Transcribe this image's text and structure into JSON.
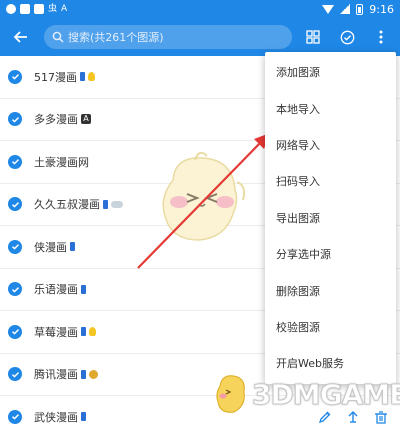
{
  "status_bar": {
    "time": "9:16",
    "left_icons": [
      "notification-icon",
      "square-icon",
      "square-icon",
      "bug-icon",
      "a-icon"
    ],
    "right_icons": [
      "wifi-icon",
      "signal-icon",
      "battery-icon"
    ]
  },
  "toolbar": {
    "search_placeholder": "搜索(共261个图源)",
    "icons": [
      "back-arrow-icon",
      "search-icon",
      "grid-icon",
      "check-circle-icon",
      "more-vert-icon"
    ]
  },
  "sources": [
    {
      "name": "517漫画",
      "tags": [
        "phone",
        "bulb"
      ]
    },
    {
      "name": "多多漫画",
      "tags": [
        "a"
      ]
    },
    {
      "name": "土豪漫画网",
      "tags": []
    },
    {
      "name": "久久五叔漫画",
      "tags": [
        "phone",
        "cloud"
      ]
    },
    {
      "name": "侠漫画",
      "tags": [
        "phone"
      ]
    },
    {
      "name": "乐语漫画",
      "tags": [
        "phone"
      ]
    },
    {
      "name": "草莓漫画",
      "tags": [
        "phone",
        "bulb"
      ]
    },
    {
      "name": "腾讯漫画",
      "tags": [
        "phone",
        "money"
      ],
      "show_actions": true
    },
    {
      "name": "武侠漫画",
      "tags": [
        "phone"
      ],
      "show_actions": true
    }
  ],
  "row_action_icons": [
    "edit-icon",
    "move-top-icon",
    "delete-icon"
  ],
  "menu": {
    "items": [
      "添加图源",
      "本地导入",
      "网络导入",
      "扫码导入",
      "导出图源",
      "分享选中源",
      "删除图源",
      "校验图源",
      "开启Web服务"
    ]
  },
  "annotation": {
    "arrow_color": "#e53935"
  },
  "watermark": {
    "text": "3DMGAME"
  },
  "colors": {
    "primary": "#1f87e6",
    "text": "#333333"
  }
}
